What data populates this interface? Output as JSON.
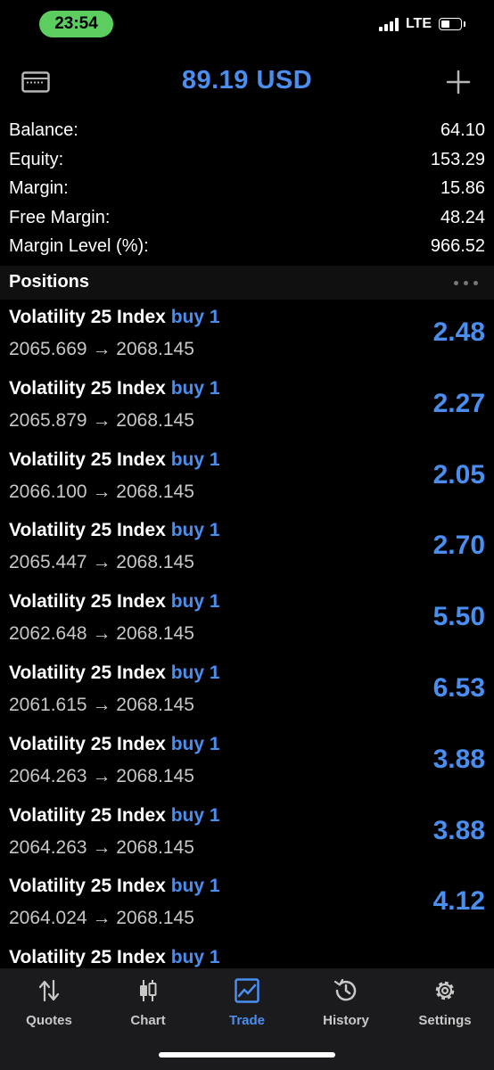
{
  "status_bar": {
    "time": "23:54",
    "network": "LTE",
    "battery_icon": "battery-icon",
    "signal_icon": "signal-icon"
  },
  "header": {
    "title": "89.19 USD",
    "left_icon": "card-icon",
    "right_icon": "plus-icon"
  },
  "summary": [
    {
      "label": "Balance:",
      "value": "64.10"
    },
    {
      "label": "Equity:",
      "value": "153.29"
    },
    {
      "label": "Margin:",
      "value": "15.86"
    },
    {
      "label": "Free Margin:",
      "value": "48.24"
    },
    {
      "label": "Margin Level (%):",
      "value": "966.52"
    }
  ],
  "positions": {
    "title": "Positions",
    "menu_icon": "more-icon",
    "items": [
      {
        "symbol": "Volatility 25 Index",
        "side": "buy 1",
        "open": "2065.669",
        "arrow": "→",
        "current": "2068.145",
        "profit": "2.48"
      },
      {
        "symbol": "Volatility 25 Index",
        "side": "buy 1",
        "open": "2065.879",
        "arrow": "→",
        "current": "2068.145",
        "profit": "2.27"
      },
      {
        "symbol": "Volatility 25 Index",
        "side": "buy 1",
        "open": "2066.100",
        "arrow": "→",
        "current": "2068.145",
        "profit": "2.05"
      },
      {
        "symbol": "Volatility 25 Index",
        "side": "buy 1",
        "open": "2065.447",
        "arrow": "→",
        "current": "2068.145",
        "profit": "2.70"
      },
      {
        "symbol": "Volatility 25 Index",
        "side": "buy 1",
        "open": "2062.648",
        "arrow": "→",
        "current": "2068.145",
        "profit": "5.50"
      },
      {
        "symbol": "Volatility 25 Index",
        "side": "buy 1",
        "open": "2061.615",
        "arrow": "→",
        "current": "2068.145",
        "profit": "6.53"
      },
      {
        "symbol": "Volatility 25 Index",
        "side": "buy 1",
        "open": "2064.263",
        "arrow": "→",
        "current": "2068.145",
        "profit": "3.88"
      },
      {
        "symbol": "Volatility 25 Index",
        "side": "buy 1",
        "open": "2064.263",
        "arrow": "→",
        "current": "2068.145",
        "profit": "3.88"
      },
      {
        "symbol": "Volatility 25 Index",
        "side": "buy 1",
        "open": "2064.024",
        "arrow": "→",
        "current": "2068.145",
        "profit": "4.12"
      },
      {
        "symbol": "Volatility 25 Index",
        "side": "buy 1",
        "open": "",
        "arrow": "",
        "current": "",
        "profit": ""
      }
    ]
  },
  "tab_bar": {
    "items": [
      {
        "label": "Quotes",
        "icon": "quotes-icon",
        "active": false
      },
      {
        "label": "Chart",
        "icon": "chart-icon",
        "active": false
      },
      {
        "label": "Trade",
        "icon": "trade-icon",
        "active": true
      },
      {
        "label": "History",
        "icon": "history-icon",
        "active": false
      },
      {
        "label": "Settings",
        "icon": "settings-icon",
        "active": false
      }
    ]
  },
  "colors": {
    "accent": "#4a8ef0",
    "time_pill": "#5ccd5f",
    "background": "#000000",
    "tab_bar_bg": "#1b1b1d"
  }
}
